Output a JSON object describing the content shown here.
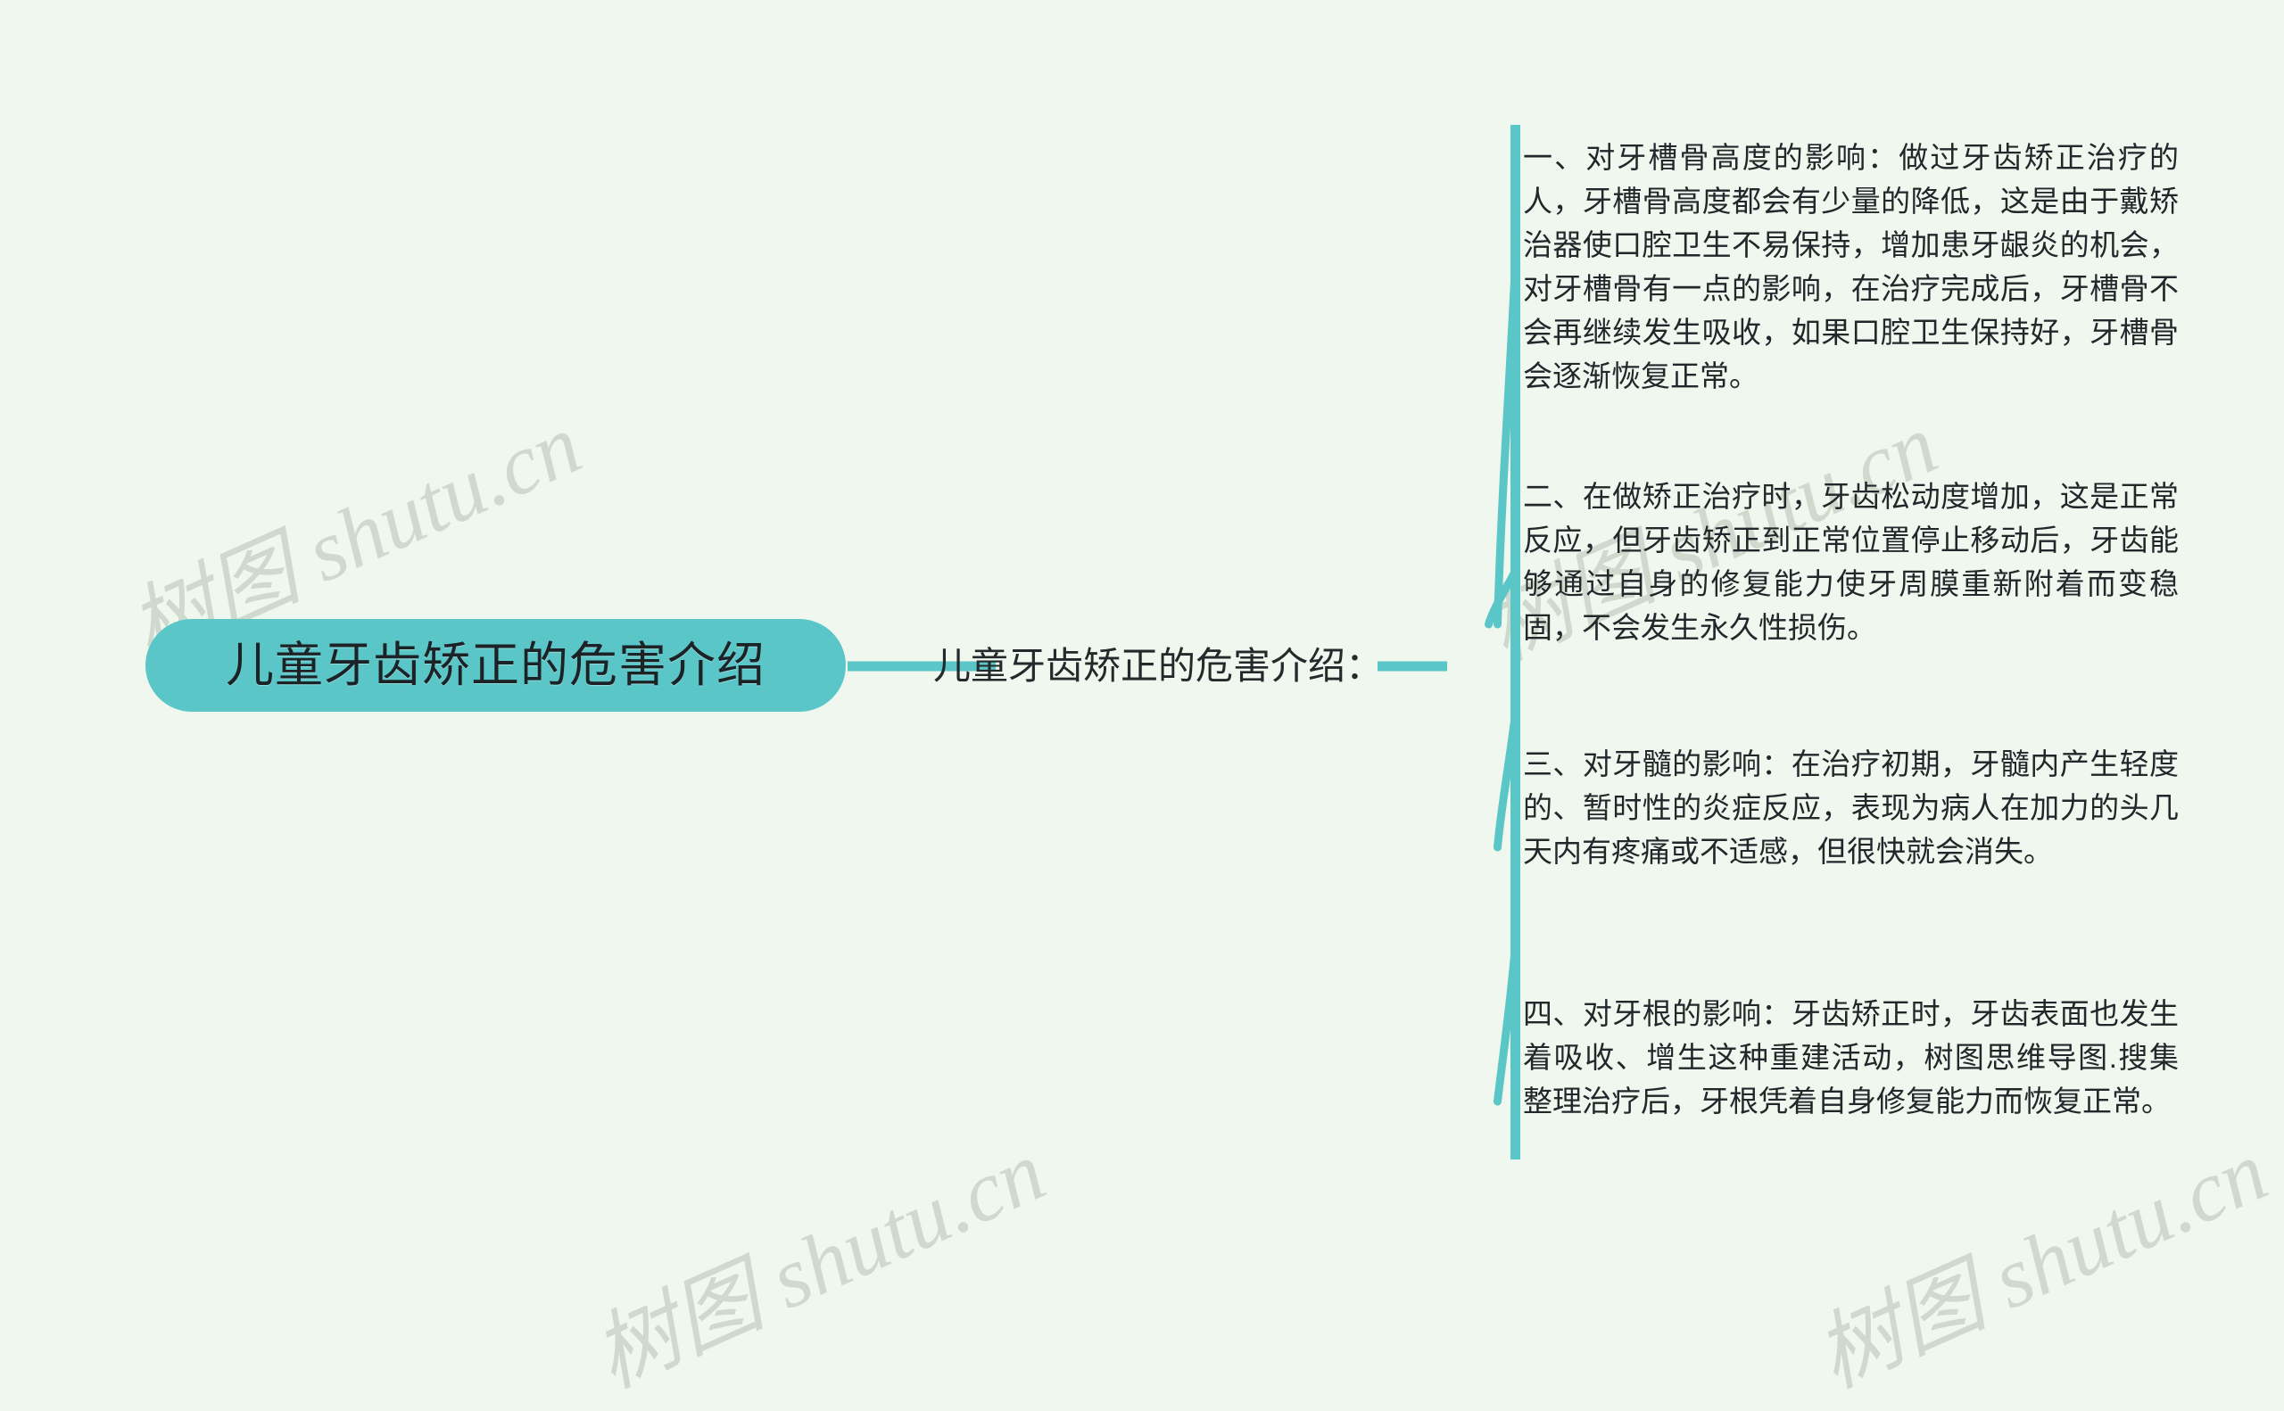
{
  "theme": {
    "background_color": "#EFF7EE",
    "accent_color": "#5BC6C8",
    "root_fill_color": "#5BC6C8",
    "text_color": "#22272B",
    "watermark_color": "#CFD9CD"
  },
  "mindmap": {
    "root": {
      "label": "儿童牙齿矫正的危害介绍"
    },
    "topic": {
      "label": "儿童牙齿矫正的危害介绍："
    },
    "branches": [
      {
        "index": "一",
        "text": "一、对牙槽骨高度的影响：做过牙齿矫正治疗的人，牙槽骨高度都会有少量的降低，这是由于戴矫治器使口腔卫生不易保持，增加患牙龈炎的机会，对牙槽骨有一点的影响，在治疗完成后，牙槽骨不会再继续发生吸收，如果口腔卫生保持好，牙槽骨会逐渐恢复正常。"
      },
      {
        "index": "二",
        "text": "二、在做矫正治疗时，牙齿松动度增加，这是正常反应，但牙齿矫正到正常位置停止移动后，牙齿能够通过自身的修复能力使牙周膜重新附着而变稳固，不会发生永久性损伤。"
      },
      {
        "index": "三",
        "text": "三、对牙髓的影响：在治疗初期，牙髓内产生轻度的、暂时性的炎症反应，表现为病人在加力的头几天内有疼痛或不适感，但很快就会消失。"
      },
      {
        "index": "四",
        "text": "四、对牙根的影响：牙齿矫正时，牙齿表面也发生着吸收、增生这种重建活动，树图思维导图.搜集整理治疗后，牙根凭着自身修复能力而恢复正常。"
      }
    ]
  },
  "watermarks": [
    {
      "text": "树图 shutu.cn"
    },
    {
      "text": "树图 shutu.cn"
    },
    {
      "text": "树图 shutu.cn"
    },
    {
      "text": "树图 shutu.cn"
    }
  ]
}
